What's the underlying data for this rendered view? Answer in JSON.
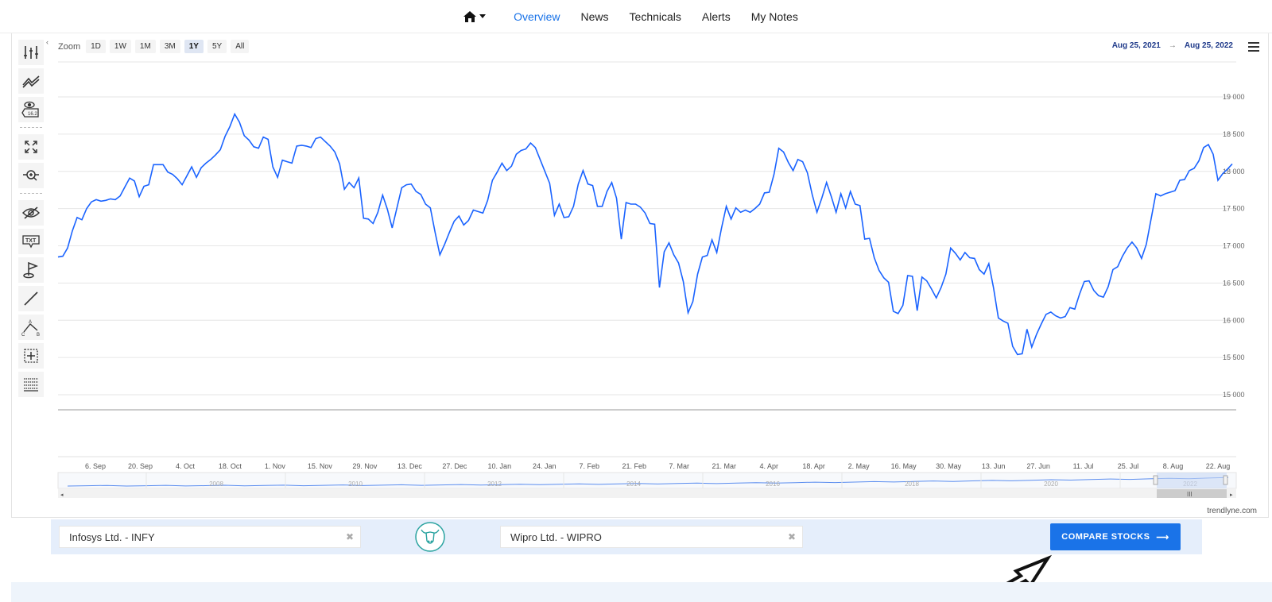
{
  "nav": {
    "items": [
      {
        "label": "Overview",
        "active": true
      },
      {
        "label": "News"
      },
      {
        "label": "Technicals"
      },
      {
        "label": "Alerts"
      },
      {
        "label": "My Notes"
      }
    ],
    "home_icon": "home-icon",
    "accent": "#1a73e8"
  },
  "toolbar": {
    "icons": [
      "indicators-icon",
      "trendline-icon",
      "annotation-price-icon",
      "fullscreen-icon",
      "zoom-search-icon",
      "hide-icon",
      "text-label-icon",
      "flag-icon",
      "line-icon",
      "pattern-icon",
      "measure-icon",
      "fibonacci-icon"
    ]
  },
  "zoom": {
    "label": "Zoom",
    "buttons": [
      "1D",
      "1W",
      "1M",
      "3M",
      "1Y",
      "5Y",
      "All"
    ],
    "active": "1Y"
  },
  "range": {
    "from": "Aug 25, 2021",
    "to": "Aug 25, 2022",
    "arrow": "→"
  },
  "credit": "trendlyne.com",
  "chart_data": {
    "type": "line",
    "color": "#1a63ff",
    "y_ticks": [
      "19 000",
      "18 500",
      "18 000",
      "17 500",
      "17 000",
      "16 500",
      "16 000",
      "15 500",
      "15 000"
    ],
    "x_ticks": [
      "6. Sep",
      "20. Sep",
      "4. Oct",
      "18. Oct",
      "1. Nov",
      "15. Nov",
      "29. Nov",
      "13. Dec",
      "27. Dec",
      "10. Jan",
      "24. Jan",
      "7. Feb",
      "21. Feb",
      "7. Mar",
      "21. Mar",
      "4. Apr",
      "18. Apr",
      "2. May",
      "16. May",
      "30. May",
      "13. Jun",
      "27. Jun",
      "11. Jul",
      "25. Jul",
      "8. Aug",
      "22. Aug"
    ],
    "navigator_years": [
      "2008",
      "2010",
      "2012",
      "2014",
      "2016",
      "2018",
      "2020",
      "2022"
    ],
    "ylim": [
      15000,
      19000
    ],
    "grid": true,
    "x_start": "Aug 25, 2021",
    "x_end": "Aug 25, 2022",
    "values": [
      16850,
      16860,
      16970,
      17200,
      17380,
      17350,
      17500,
      17590,
      17620,
      17600,
      17610,
      17630,
      17620,
      17670,
      17790,
      17910,
      17870,
      17660,
      17800,
      17820,
      18090,
      18090,
      18090,
      17990,
      17960,
      17900,
      17820,
      17940,
      18060,
      17920,
      18050,
      18110,
      18160,
      18220,
      18290,
      18470,
      18600,
      18770,
      18660,
      18480,
      18420,
      18330,
      18310,
      18460,
      18430,
      18060,
      17920,
      18150,
      18130,
      18110,
      18340,
      18350,
      18340,
      18320,
      18440,
      18460,
      18400,
      18340,
      18260,
      18100,
      17760,
      17850,
      17780,
      17910,
      17370,
      17360,
      17300,
      17450,
      17680,
      17490,
      17240,
      17510,
      17780,
      17820,
      17830,
      17730,
      17690,
      17560,
      17510,
      17180,
      16880,
      17020,
      17180,
      17330,
      17400,
      17280,
      17340,
      17480,
      17460,
      17440,
      17610,
      17880,
      17990,
      18110,
      18010,
      18070,
      18230,
      18280,
      18300,
      18380,
      18320,
      18160,
      18000,
      17840,
      17410,
      17560,
      17380,
      17390,
      17530,
      17830,
      18010,
      17830,
      17810,
      17530,
      17530,
      17730,
      17850,
      17640,
      17090,
      17580,
      17560,
      17560,
      17520,
      17440,
      17300,
      17290,
      16440,
      16920,
      17040,
      16880,
      16770,
      16520,
      16100,
      16250,
      16620,
      16850,
      16870,
      17080,
      16910,
      17240,
      17530,
      17360,
      17510,
      17450,
      17480,
      17450,
      17500,
      17560,
      17710,
      17720,
      17960,
      18310,
      18260,
      18120,
      18010,
      18160,
      18130,
      17980,
      17690,
      17450,
      17640,
      17850,
      17660,
      17450,
      17700,
      17510,
      17730,
      17560,
      17540,
      17090,
      17100,
      16840,
      16670,
      16570,
      16510,
      16120,
      16090,
      16200,
      16600,
      16590,
      16130,
      16580,
      16530,
      16420,
      16300,
      16440,
      16620,
      16970,
      16900,
      16810,
      16910,
      16840,
      16830,
      16680,
      16620,
      16760,
      16430,
      16030,
      15990,
      15960,
      15650,
      15540,
      15550,
      15880,
      15640,
      15810,
      15950,
      16080,
      16110,
      16060,
      16030,
      16050,
      16170,
      16150,
      16350,
      16520,
      16530,
      16400,
      16330,
      16310,
      16450,
      16680,
      16720,
      16860,
      16970,
      17050,
      16970,
      16830,
      17020,
      17360,
      17700,
      17670,
      17700,
      17720,
      17740,
      17880,
      17890,
      18010,
      18040,
      18140,
      18320,
      18360,
      18230,
      17880,
      17970,
      18030,
      18100
    ]
  },
  "compare": {
    "stock1": "Infosys Ltd. - INFY",
    "stock2": "Wipro Ltd. - WIPRO",
    "clear_icon": "✖",
    "button_label": "COMPARE STOCKS",
    "button_arrow": "⟶",
    "logo": "bull-logo-icon"
  }
}
